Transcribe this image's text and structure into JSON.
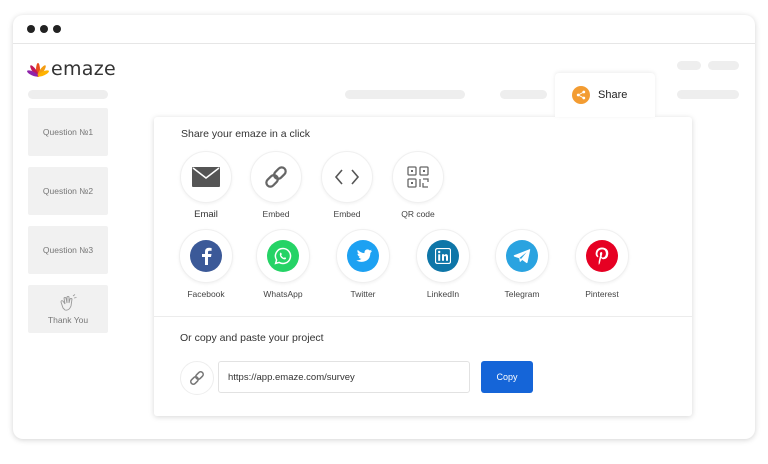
{
  "brand": {
    "name": "emaze"
  },
  "share_tab": {
    "label": "Share"
  },
  "sidebar": {
    "items": [
      {
        "label": "Question №1"
      },
      {
        "label": "Question №2"
      },
      {
        "label": "Question №3"
      },
      {
        "label": "Thank You"
      }
    ]
  },
  "share_panel": {
    "title": "Share your emaze in a click",
    "options": [
      {
        "label": "Email",
        "icon": "envelope-icon"
      },
      {
        "label": "Embed",
        "icon": "link-icon"
      },
      {
        "label": "Embed",
        "icon": "code-icon"
      },
      {
        "label": "QR code",
        "icon": "qr-code-icon"
      }
    ],
    "social": [
      {
        "label": "Facebook",
        "icon": "facebook-icon",
        "color": "#3b5998"
      },
      {
        "label": "WhatsApp",
        "icon": "whatsapp-icon",
        "color": "#25d366"
      },
      {
        "label": "Twitter",
        "icon": "twitter-icon",
        "color": "#1da1f2"
      },
      {
        "label": "LinkedIn",
        "icon": "linkedin-icon",
        "color": "#0e76a8"
      },
      {
        "label": "Telegram",
        "icon": "telegram-icon",
        "color": "#2aa3e0"
      },
      {
        "label": "Pinterest",
        "icon": "pinterest-icon",
        "color": "#e60023"
      }
    ]
  },
  "copy": {
    "title": "Or copy and paste your project",
    "url": "https://app.emaze.com/survey",
    "button_label": "Copy"
  },
  "colors": {
    "accent": "#1565d8",
    "share_icon": "#f39c32"
  }
}
